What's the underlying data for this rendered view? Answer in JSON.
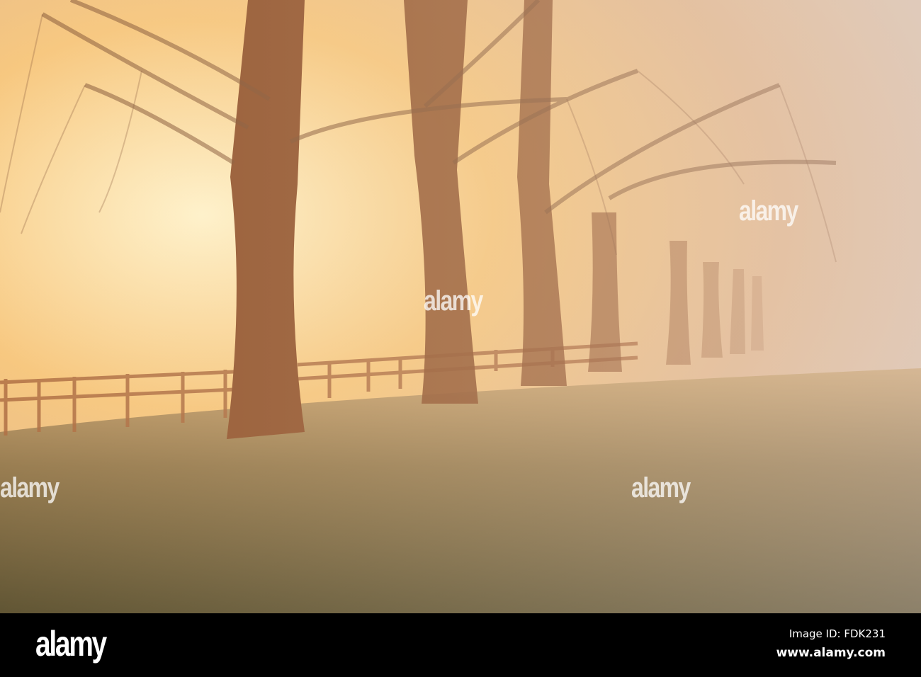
{
  "watermark": {
    "brand": "alamy"
  },
  "footer": {
    "logo": "alamy",
    "image_id": "Image ID: FDK231",
    "website": "www.alamy.com"
  }
}
